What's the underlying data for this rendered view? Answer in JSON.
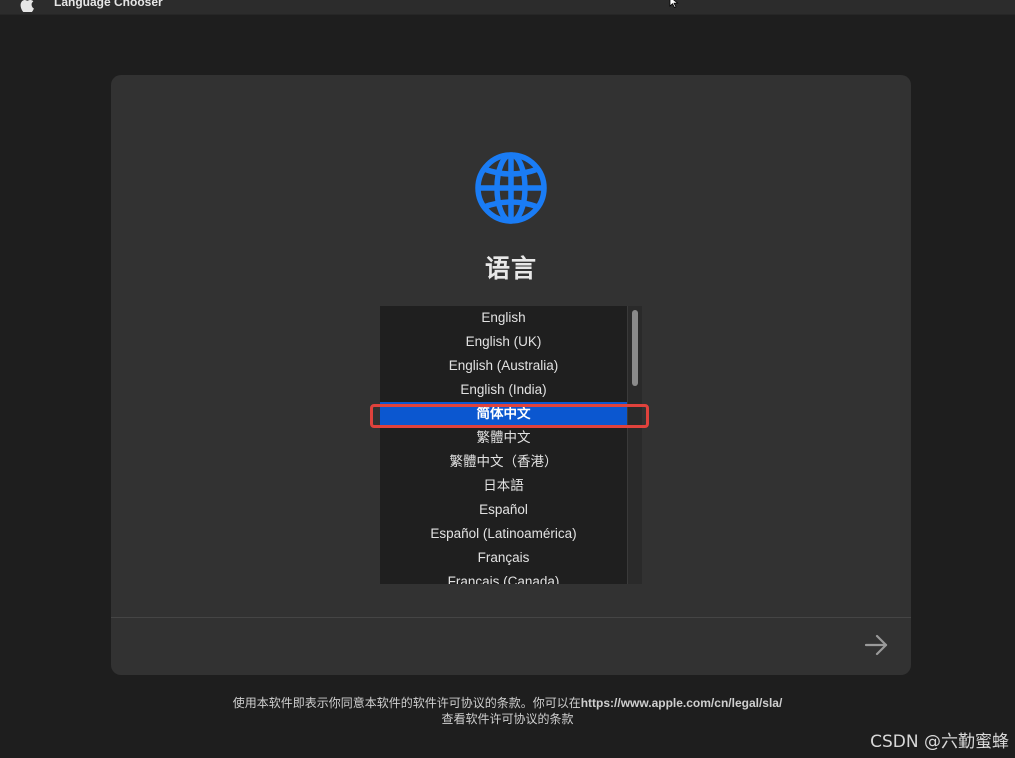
{
  "menubar": {
    "app_name": "Language Chooser"
  },
  "panel": {
    "title": "语言",
    "languages": [
      {
        "label": "English"
      },
      {
        "label": "English (UK)"
      },
      {
        "label": "English (Australia)"
      },
      {
        "label": "English (India)"
      },
      {
        "label": "简体中文",
        "selected": true
      },
      {
        "label": "繁體中文"
      },
      {
        "label": "繁體中文（香港）"
      },
      {
        "label": "日本語"
      },
      {
        "label": "Español"
      },
      {
        "label": "Español (Latinoamérica)"
      },
      {
        "label": "Français"
      },
      {
        "label": "Français (Canada)"
      }
    ]
  },
  "license": {
    "line1_prefix": "使用本软件即表示你同意本软件的软件许可协议的条款。你可以在",
    "url": "https://www.apple.com/cn/legal/sla/",
    "line2": "查看软件许可协议的条款"
  },
  "watermark": {
    "text": "CSDN @六勤蜜蜂"
  },
  "colors": {
    "background": "#1e1e1e",
    "panel": "#323232",
    "accent_globe": "#1a7cf5",
    "selection": "#0b57d0",
    "annotation_box": "#e0423c"
  },
  "icons": {
    "menubar_logo": "apple-logo-icon",
    "hero": "globe-icon",
    "continue": "arrow-right-icon",
    "pointer": "mouse-cursor-icon"
  }
}
